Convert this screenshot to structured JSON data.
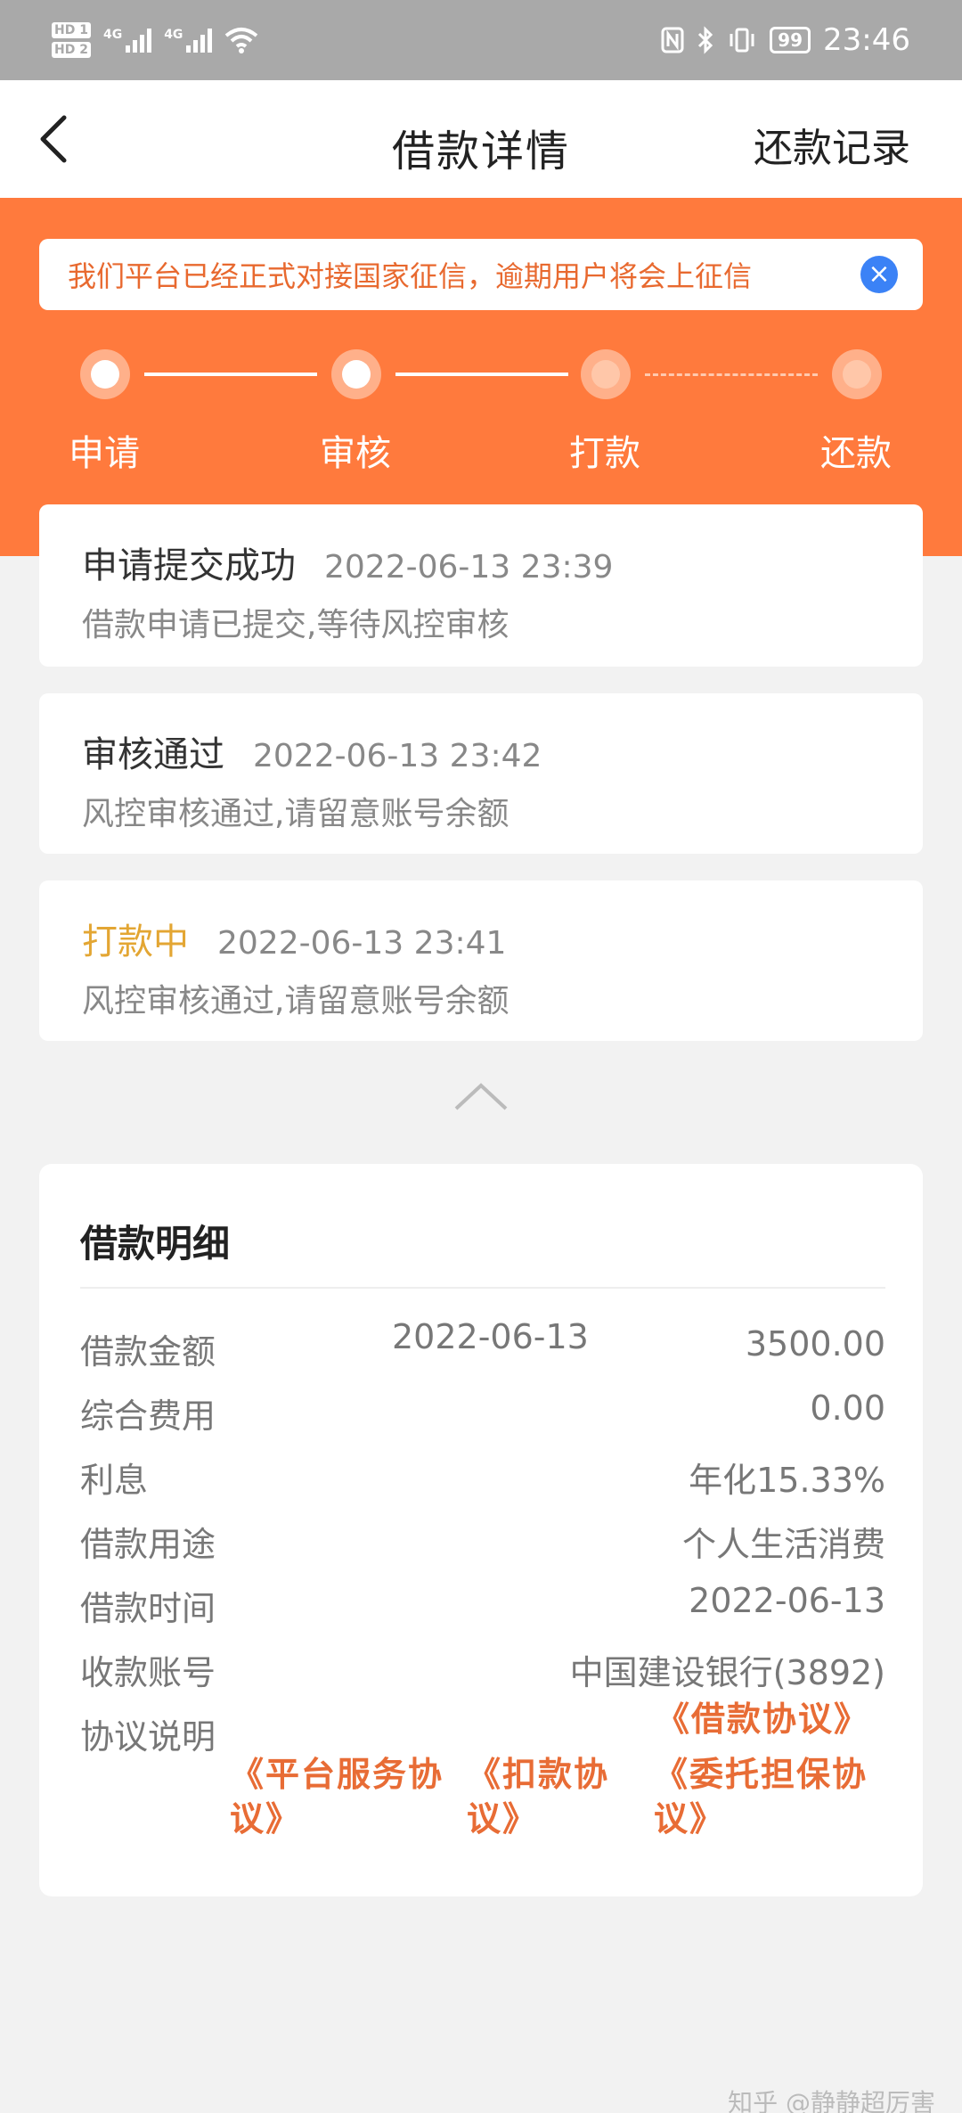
{
  "status_bar": {
    "hd1": "HD 1",
    "hd2": "HD 2",
    "sig1": "4G",
    "sig2": "4G",
    "battery": "99",
    "time": "23:46"
  },
  "nav": {
    "title": "借款详情",
    "right_link": "还款记录"
  },
  "notice": {
    "text": "我们平台已经正式对接国家征信，逾期用户将会上征信"
  },
  "steps": [
    "申请",
    "审核",
    "打款",
    "还款"
  ],
  "timeline": [
    {
      "title": "申请提交成功",
      "time": "2022-06-13 23:39",
      "desc": "借款申请已提交,等待风控审核"
    },
    {
      "title": "审核通过",
      "time": "2022-06-13 23:42",
      "desc": "风控审核通过,请留意账号余额"
    },
    {
      "title": "打款中",
      "time": "2022-06-13 23:41",
      "desc": "风控审核通过,请留意账号余额"
    }
  ],
  "detail": {
    "title": "借款明细",
    "amount_date": "2022-06-13",
    "rows": [
      {
        "label": "借款金额",
        "value": "3500.00"
      },
      {
        "label": "综合费用",
        "value": "0.00"
      },
      {
        "label": "利息",
        "value": "年化15.33%"
      },
      {
        "label": "借款用途",
        "value": "个人生活消费"
      },
      {
        "label": "借款时间",
        "value": "2022-06-13"
      },
      {
        "label": "收款账号",
        "value": "中国建设银行(3892)"
      },
      {
        "label": "协议说明",
        "value": "《借款协议》"
      }
    ],
    "agreements": {
      "platform_1": "《平台服务协",
      "platform_2": "议》",
      "deduct_1": "《扣款协",
      "deduct_2": "议》",
      "guarantee_1": "《委托担保协",
      "guarantee_2": "议》"
    }
  },
  "watermark": "知乎 @静静超厉害",
  "colors": {
    "accent": "#ff7a3d",
    "notice_text": "#e8692f",
    "pending": "#e3a633",
    "link": "#e86c35",
    "close": "#3b82f6"
  }
}
